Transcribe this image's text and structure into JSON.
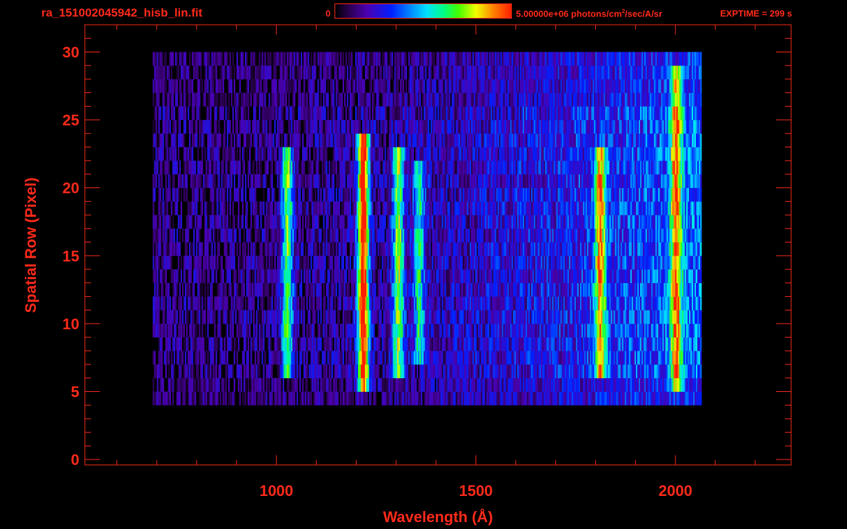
{
  "header": {
    "filename": "ra_151002045942_hisb_lin.fit",
    "colorbar_min_label": "0",
    "colorbar_max_label_main": "5.00000e+06 photons/cm",
    "colorbar_max_label_sup": "2",
    "colorbar_max_label_tail": "/sec/A/sr",
    "exptime_label": "EXPTIME = 299 s"
  },
  "colors": {
    "axis": "#ff2a1a",
    "background": "#000000"
  },
  "chart_data": {
    "type": "heatmap",
    "title": "ra_151002045942_hisb_lin.fit",
    "xlabel": "Wavelength (Å)",
    "ylabel": "Spatial Row (Pixel)",
    "xlim": [
      520,
      2290
    ],
    "ylim": [
      -0.4,
      32
    ],
    "x_ticks": [
      1000,
      1500,
      2000
    ],
    "y_ticks": [
      0,
      5,
      10,
      15,
      20,
      25,
      30
    ],
    "colorbar": {
      "min": 0,
      "max": 5000000,
      "unit": "photons/cm^2/sec/A/sr",
      "colormap": "rainbow"
    },
    "signal_extent": {
      "wavelength": [
        690,
        2065
      ],
      "rows": [
        4,
        30
      ]
    },
    "emission_features": [
      {
        "wavelength": 1026,
        "rows": [
          6,
          23
        ],
        "peak": 0.55
      },
      {
        "wavelength": 1216,
        "rows": [
          5,
          24
        ],
        "peak": 0.9
      },
      {
        "wavelength": 1304,
        "rows": [
          6,
          23
        ],
        "peak": 0.55
      },
      {
        "wavelength": 1356,
        "rows": [
          7,
          22
        ],
        "peak": 0.4
      },
      {
        "wavelength": 1810,
        "rows": [
          6,
          23
        ],
        "peak": 0.6
      },
      {
        "wavelength": 2000,
        "rows": [
          5,
          29
        ],
        "peak": 0.6
      }
    ]
  }
}
